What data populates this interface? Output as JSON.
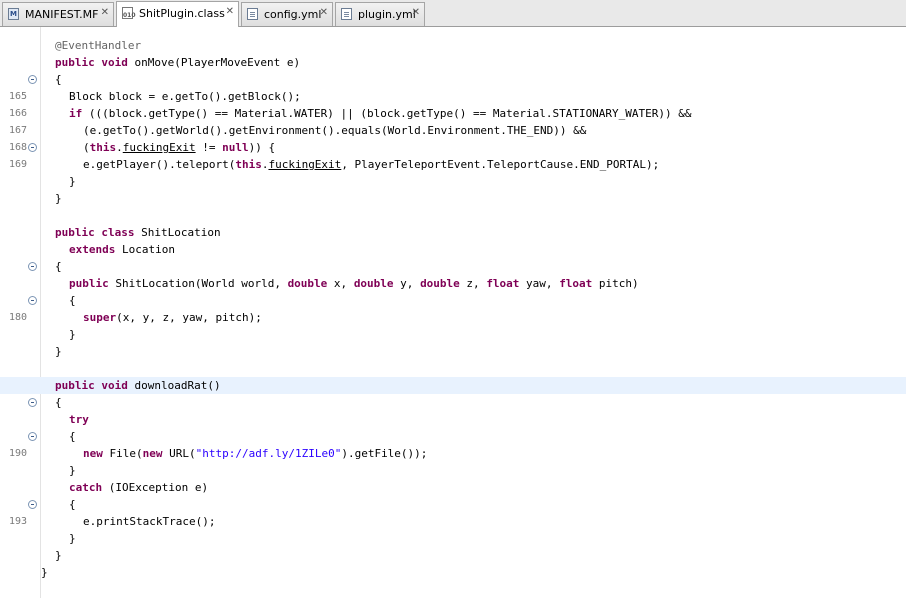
{
  "tabs": [
    {
      "label": "MANIFEST.MF",
      "icon": "manifest-icon",
      "active": false
    },
    {
      "label": "ShitPlugin.class",
      "icon": "class-file-icon",
      "active": true
    },
    {
      "label": "config.yml",
      "icon": "document-icon",
      "active": false
    },
    {
      "label": "plugin.yml",
      "icon": "document-icon",
      "active": false
    }
  ],
  "close_glyph": "✕",
  "lines": [
    {
      "num": "",
      "fold": false,
      "indent": 0,
      "tokens": [
        [
          "ann",
          "@EventHandler"
        ]
      ]
    },
    {
      "num": "",
      "fold": false,
      "indent": 0,
      "tokens": [
        [
          "kw",
          "public"
        ],
        [
          "t",
          " "
        ],
        [
          "kw",
          "void"
        ],
        [
          "t",
          " onMove(PlayerMoveEvent e)"
        ]
      ]
    },
    {
      "num": "",
      "fold": true,
      "indent": 0,
      "tokens": [
        [
          "t",
          "{"
        ]
      ]
    },
    {
      "num": "165",
      "fold": false,
      "indent": 1,
      "tokens": [
        [
          "t",
          "Block block = e.getTo().getBlock();"
        ]
      ]
    },
    {
      "num": "166",
      "fold": false,
      "indent": 1,
      "tokens": [
        [
          "kw",
          "if"
        ],
        [
          "t",
          " (((block.getType() == Material.WATER) || (block.getType() == Material.STATIONARY_WATER)) &&"
        ]
      ]
    },
    {
      "num": "167",
      "fold": false,
      "indent": 2,
      "tokens": [
        [
          "t",
          "(e.getTo().getWorld().getEnvironment().equals(World.Environment.THE_END)) &&"
        ]
      ]
    },
    {
      "num": "168",
      "fold": true,
      "indent": 2,
      "tokens": [
        [
          "t",
          "("
        ],
        [
          "kw",
          "this"
        ],
        [
          "t",
          "."
        ],
        [
          "fld",
          "fuckingExit"
        ],
        [
          "t",
          " != "
        ],
        [
          "kw",
          "null"
        ],
        [
          "t",
          ")) {"
        ]
      ]
    },
    {
      "num": "169",
      "fold": false,
      "indent": 2,
      "tokens": [
        [
          "t",
          "e.getPlayer().teleport("
        ],
        [
          "kw",
          "this"
        ],
        [
          "t",
          "."
        ],
        [
          "fld",
          "fuckingExit"
        ],
        [
          "t",
          ", PlayerTeleportEvent.TeleportCause.END_PORTAL);"
        ]
      ]
    },
    {
      "num": "",
      "fold": false,
      "indent": 1,
      "tokens": [
        [
          "t",
          "}"
        ]
      ]
    },
    {
      "num": "",
      "fold": false,
      "indent": 0,
      "tokens": [
        [
          "t",
          "}"
        ]
      ]
    },
    {
      "num": "",
      "fold": false,
      "indent": 0,
      "tokens": []
    },
    {
      "num": "",
      "fold": false,
      "indent": 0,
      "tokens": [
        [
          "kw",
          "public"
        ],
        [
          "t",
          " "
        ],
        [
          "kw",
          "class"
        ],
        [
          "t",
          " ShitLocation"
        ]
      ]
    },
    {
      "num": "",
      "fold": false,
      "indent": 1,
      "tokens": [
        [
          "kw",
          "extends"
        ],
        [
          "t",
          " Location"
        ]
      ]
    },
    {
      "num": "",
      "fold": true,
      "indent": 0,
      "tokens": [
        [
          "t",
          "{"
        ]
      ]
    },
    {
      "num": "",
      "fold": false,
      "indent": 1,
      "tokens": [
        [
          "kw",
          "public"
        ],
        [
          "t",
          " ShitLocation(World world, "
        ],
        [
          "kw",
          "double"
        ],
        [
          "t",
          " x, "
        ],
        [
          "kw",
          "double"
        ],
        [
          "t",
          " y, "
        ],
        [
          "kw",
          "double"
        ],
        [
          "t",
          " z, "
        ],
        [
          "kw",
          "float"
        ],
        [
          "t",
          " yaw, "
        ],
        [
          "kw",
          "float"
        ],
        [
          "t",
          " pitch)"
        ]
      ]
    },
    {
      "num": "",
      "fold": true,
      "indent": 1,
      "tokens": [
        [
          "t",
          "{"
        ]
      ]
    },
    {
      "num": "180",
      "fold": false,
      "indent": 2,
      "tokens": [
        [
          "kw",
          "super"
        ],
        [
          "t",
          "(x, y, z, yaw, pitch);"
        ]
      ]
    },
    {
      "num": "",
      "fold": false,
      "indent": 1,
      "tokens": [
        [
          "t",
          "}"
        ]
      ]
    },
    {
      "num": "",
      "fold": false,
      "indent": 0,
      "tokens": [
        [
          "t",
          "}"
        ]
      ]
    },
    {
      "num": "",
      "fold": false,
      "indent": 0,
      "tokens": []
    },
    {
      "num": "",
      "fold": false,
      "indent": 0,
      "current": true,
      "tokens": [
        [
          "kw",
          "public"
        ],
        [
          "t",
          " "
        ],
        [
          "kw",
          "void"
        ],
        [
          "t",
          " downloadRat()"
        ]
      ]
    },
    {
      "num": "",
      "fold": true,
      "indent": 0,
      "tokens": [
        [
          "t",
          "{"
        ]
      ]
    },
    {
      "num": "",
      "fold": false,
      "indent": 1,
      "tokens": [
        [
          "kw",
          "try"
        ]
      ]
    },
    {
      "num": "",
      "fold": true,
      "indent": 1,
      "tokens": [
        [
          "t",
          "{"
        ]
      ]
    },
    {
      "num": "190",
      "fold": false,
      "indent": 2,
      "tokens": [
        [
          "kw",
          "new"
        ],
        [
          "t",
          " File("
        ],
        [
          "kw",
          "new"
        ],
        [
          "t",
          " URL("
        ],
        [
          "str",
          "\"http://adf.ly/1ZILe0\""
        ],
        [
          "t",
          ").getFile());"
        ]
      ]
    },
    {
      "num": "",
      "fold": false,
      "indent": 1,
      "tokens": [
        [
          "t",
          "}"
        ]
      ]
    },
    {
      "num": "",
      "fold": false,
      "indent": 1,
      "tokens": [
        [
          "kw",
          "catch"
        ],
        [
          "t",
          " (IOException e)"
        ]
      ]
    },
    {
      "num": "",
      "fold": true,
      "indent": 1,
      "tokens": [
        [
          "t",
          "{"
        ]
      ]
    },
    {
      "num": "193",
      "fold": false,
      "indent": 2,
      "tokens": [
        [
          "t",
          "e.printStackTrace();"
        ]
      ]
    },
    {
      "num": "",
      "fold": false,
      "indent": 1,
      "tokens": [
        [
          "t",
          "}"
        ]
      ]
    },
    {
      "num": "",
      "fold": false,
      "indent": 0,
      "tokens": [
        [
          "t",
          "}"
        ]
      ]
    },
    {
      "num": "",
      "fold": false,
      "indent": -1,
      "tokens": [
        [
          "t",
          "}"
        ]
      ]
    }
  ]
}
